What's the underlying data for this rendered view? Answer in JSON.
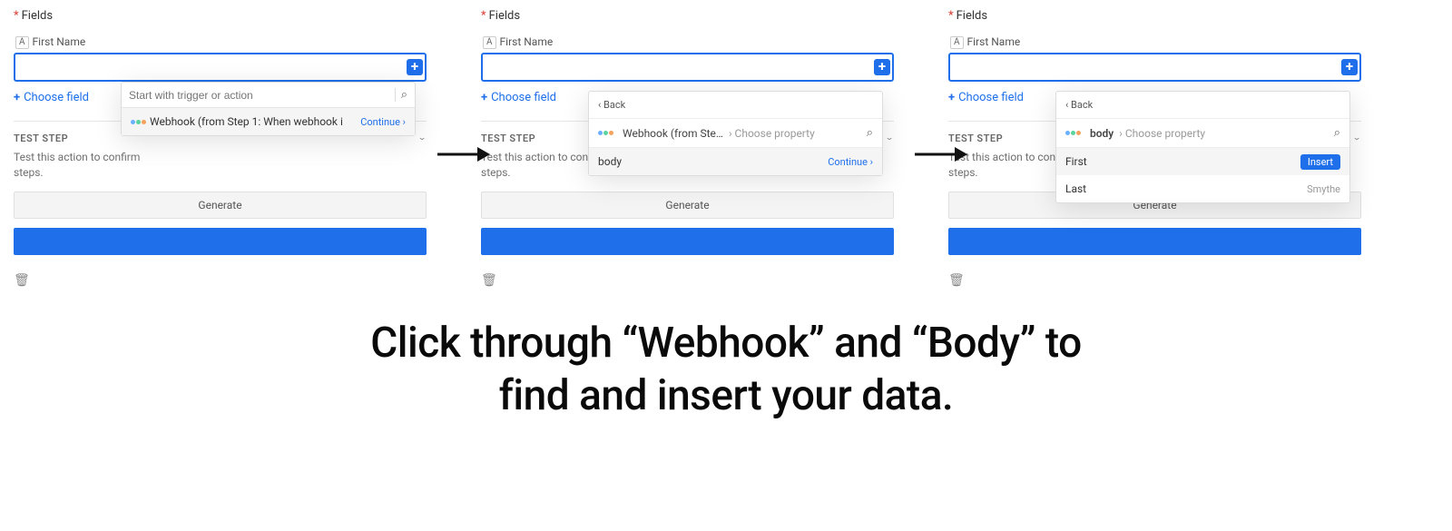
{
  "fields_label": "Fields",
  "field_type": "A",
  "field_name": "First Name",
  "choose_field": "Choose field",
  "test_section": {
    "title": "TEST STEP",
    "desc_short": "Test this action to confirm",
    "desc_steps": "steps.",
    "generate": "Generate"
  },
  "popover1": {
    "search_placeholder": "Start with trigger or action",
    "row_label": "Webhook (from Step 1: When webhook i",
    "row_action": "Continue ›"
  },
  "popover2": {
    "back": "Back",
    "crumb": "Webhook (from Ste…",
    "hint": "Choose property",
    "row_label": "body",
    "row_action": "Continue ›"
  },
  "popover3": {
    "back": "Back",
    "crumb": "body",
    "hint": "Choose property",
    "rows": [
      {
        "label": "First",
        "action": "Insert",
        "value": ""
      },
      {
        "label": "Last",
        "action": "",
        "value": "Smythe"
      }
    ]
  },
  "caption_line1": "Click through “Webhook” and “Body” to",
  "caption_line2": "find and insert your data."
}
